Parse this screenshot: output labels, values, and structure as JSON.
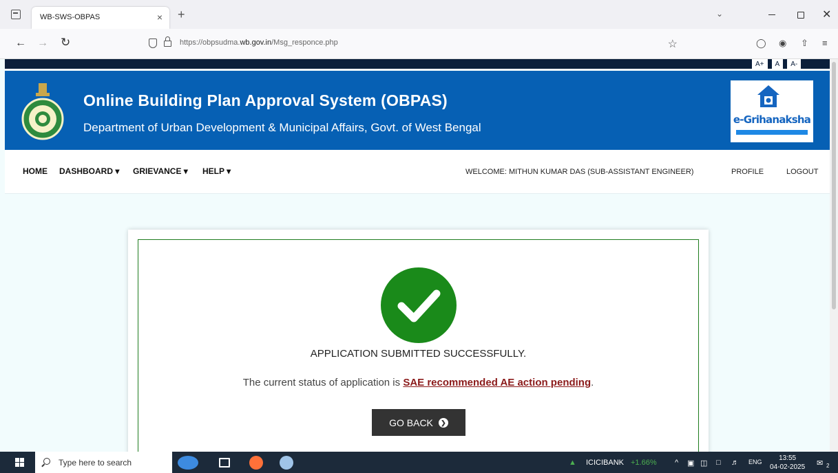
{
  "browser": {
    "tab_title": "WB-SWS-OBPAS",
    "tab_close": "×",
    "new_tab": "+",
    "url_prefix": "https://obpsudma.",
    "url_domain": "wb.gov.in",
    "url_path": "/Msg_responce.php"
  },
  "font_controls": [
    "A+",
    "A",
    "A-"
  ],
  "banner": {
    "title": "Online Building Plan Approval System (OBPAS)",
    "subtitle": "Department of Urban Development & Municipal Affairs, Govt. of West Bengal",
    "logo_text": "e-Grihanaksha",
    "brand_color": "#0660b4"
  },
  "menu": {
    "home": "HOME",
    "dashboard": "DASHBOARD ▾",
    "grievance": "GRIEVANCE ▾",
    "help": "HELP ▾",
    "welcome": "WELCOME: MITHUN KUMAR DAS (SUB-ASSISTANT ENGINEER)",
    "profile": "PROFILE",
    "logout": "LOGOUT"
  },
  "result": {
    "success_message": "APPLICATION SUBMITTED SUCCESSFULLY.",
    "status_prefix": "The current status of application is ",
    "status_value": "SAE recommended AE action pending",
    "status_suffix": ".",
    "go_back_label": "GO BACK",
    "success_color": "#1a8a1a"
  },
  "taskbar": {
    "search_placeholder": "Type here to search",
    "stock_name": "ICICIBANK",
    "stock_change": "+1.66%",
    "lang": "ENG",
    "time": "13:55",
    "date": "04-02-2025",
    "notification_count": "2"
  }
}
